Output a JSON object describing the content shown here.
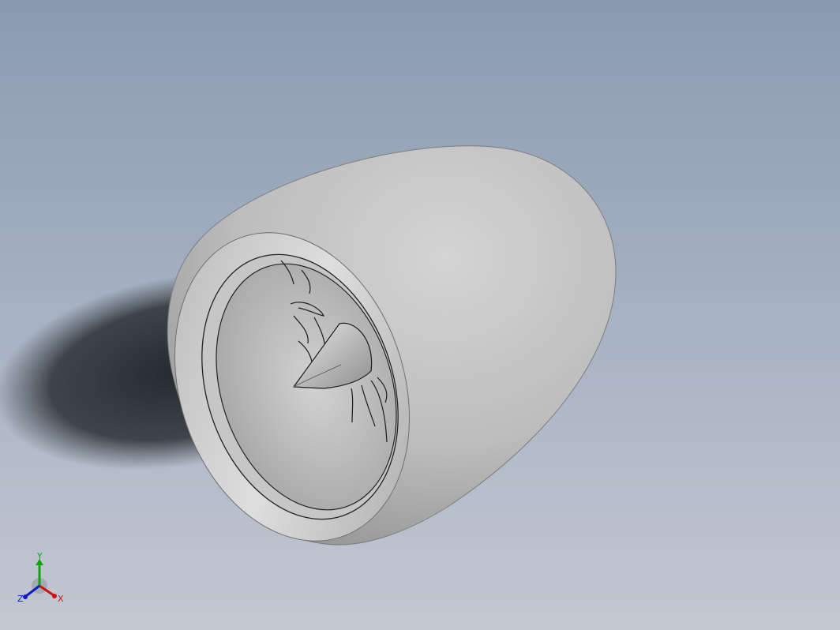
{
  "viewport": {
    "background_top": "#8a9bb2",
    "background_bottom": "#c3c8d2",
    "model_color": "#c9c9c9"
  },
  "triad": {
    "x_label": "X",
    "y_label": "Y",
    "z_label": "Z",
    "x_color": "#d01010",
    "y_color": "#10a010",
    "z_color": "#1020c0"
  }
}
